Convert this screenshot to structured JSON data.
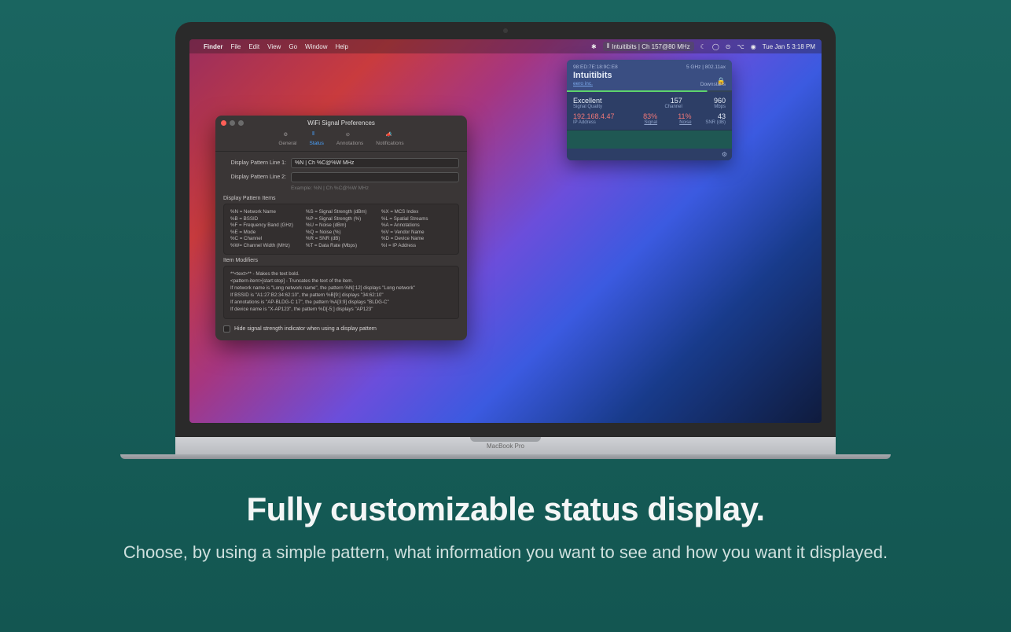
{
  "menubar": {
    "app": "Finder",
    "items": [
      "File",
      "Edit",
      "View",
      "Go",
      "Window",
      "Help"
    ],
    "status_pill": "Intuitibits | Ch 157@80 MHz",
    "datetime": "Tue Jan 5  3:18 PM"
  },
  "prefs": {
    "title": "WiFi Signal Preferences",
    "tabs": {
      "general": "General",
      "status": "Status",
      "annotations": "Annotations",
      "notifications": "Notifications"
    },
    "line1_label": "Display Pattern Line 1:",
    "line1_value": "%N | Ch %C@%W MHz",
    "line2_label": "Display Pattern Line 2:",
    "line2_value": "",
    "example": "Example: %N | Ch %C@%W MHz",
    "items_header": "Display Pattern Items",
    "col1": [
      "%N = Network Name",
      "%B = BSSID",
      "%F = Frequency Band (GHz)",
      "%E = Mode",
      "%C = Channel",
      "%W= Channel Width (MHz)"
    ],
    "col2": [
      "%S = Signal Strength (dBm)",
      "%P = Signal Strength (%)",
      "%U = Noise (dBm)",
      "%Q = Noise (%)",
      "%R = SNR (dB)",
      "%T = Data Rate (Mbps)"
    ],
    "col3": [
      "%X = MCS Index",
      "%L = Spatial Streams",
      "%A = Annotations",
      "%V = Vendor Name",
      "%D = Device Name",
      "%I  = IP Address"
    ],
    "mods_header": "Item Modifiers",
    "mods": [
      "**<text>**                       - Makes the text bold.",
      "<pattern-item>[start:stop]   - Truncates the text of the item.",
      "If network name is \"Long network name\", the pattern %N[:12] displays \"Long network\"",
      "If BSSID is \"A1:27:B2:34:62:10\", the pattern %B[9:] displays \"34:62:10\"",
      "If annotations is \"AP-BLDG-C 17\", the pattern %A[3:9] displays \"BLDG-C\"",
      "If device name is \"X-AP123\", the pattern %D[-5:] displays \"AP123\""
    ],
    "checkbox": "Hide signal strength indicator when using a display pattern"
  },
  "popover": {
    "bssid": "98:ED:7E:18:9C:E8",
    "band": "5 GHz | 802.11ax",
    "ssid": "Intuitibits",
    "vendor": "eero inc.",
    "annotation": "Downstairs",
    "quality_v": "Excellent",
    "quality_l": "Signal Quality",
    "channel_v": "157",
    "channel_l": "Channel",
    "rate_v": "960",
    "rate_l": "Mbps",
    "ip_v": "192.168.4.47",
    "ip_l": "IP Address",
    "signal_v": "83%",
    "signal_l": "Signal",
    "noise_v": "11%",
    "noise_l": "Noise",
    "snr_v": "43",
    "snr_l": "SNR (dB)"
  },
  "hardware": "MacBook Pro",
  "headline": {
    "title": "Fully customizable status display.",
    "subtitle": "Choose, by using a simple pattern, what information you want to see and how you want it displayed."
  }
}
